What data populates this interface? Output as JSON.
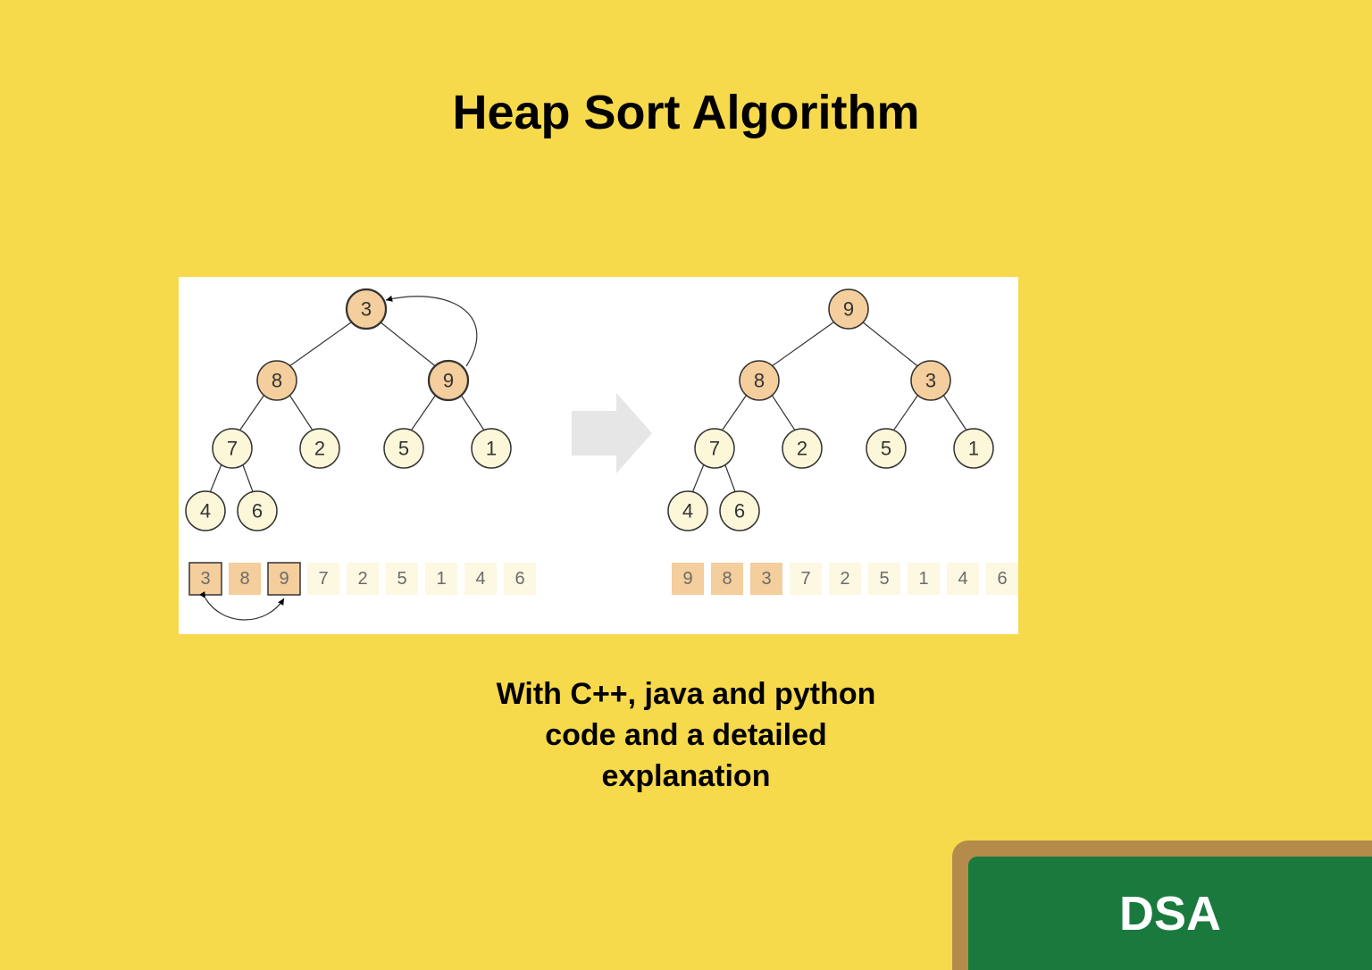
{
  "title": "Heap Sort Algorithm",
  "subtitle_line1": "With C++, java and python",
  "subtitle_line2": "code and a detailed",
  "subtitle_line3": "explanation",
  "board_label": "DSA",
  "colors": {
    "background": "#f7d94c",
    "panel": "#ffffff",
    "node_light": "#fdf7da",
    "node_dark": "#f4ce9c",
    "board_frame": "#b48b4a",
    "board_inner": "#1a7a3e"
  },
  "diagram": {
    "left_tree": {
      "nodes": [
        {
          "id": "L0",
          "value": 3,
          "shade": "dark",
          "bold": true
        },
        {
          "id": "L1",
          "value": 8,
          "shade": "dark",
          "bold": false
        },
        {
          "id": "L2",
          "value": 9,
          "shade": "dark",
          "bold": true
        },
        {
          "id": "L3",
          "value": 7,
          "shade": "light",
          "bold": false
        },
        {
          "id": "L4",
          "value": 2,
          "shade": "light",
          "bold": false
        },
        {
          "id": "L5",
          "value": 5,
          "shade": "light",
          "bold": false
        },
        {
          "id": "L6",
          "value": 1,
          "shade": "light",
          "bold": false
        },
        {
          "id": "L7",
          "value": 4,
          "shade": "light",
          "bold": false
        },
        {
          "id": "L8",
          "value": 6,
          "shade": "light",
          "bold": false
        }
      ],
      "edges": [
        [
          "L0",
          "L1"
        ],
        [
          "L0",
          "L2"
        ],
        [
          "L1",
          "L3"
        ],
        [
          "L1",
          "L4"
        ],
        [
          "L2",
          "L5"
        ],
        [
          "L2",
          "L6"
        ],
        [
          "L3",
          "L7"
        ],
        [
          "L3",
          "L8"
        ]
      ],
      "swap_arrow_tree": [
        "L0",
        "L2"
      ],
      "array": [
        3,
        8,
        9,
        7,
        2,
        5,
        1,
        4,
        6
      ],
      "array_highlight_indices": [
        0,
        1,
        2
      ],
      "array_border_indices": [
        0,
        2
      ],
      "array_swap_arrow": [
        0,
        2
      ]
    },
    "right_tree": {
      "nodes": [
        {
          "id": "R0",
          "value": 9,
          "shade": "dark"
        },
        {
          "id": "R1",
          "value": 8,
          "shade": "dark"
        },
        {
          "id": "R2",
          "value": 3,
          "shade": "dark"
        },
        {
          "id": "R3",
          "value": 7,
          "shade": "light"
        },
        {
          "id": "R4",
          "value": 2,
          "shade": "light"
        },
        {
          "id": "R5",
          "value": 5,
          "shade": "light"
        },
        {
          "id": "R6",
          "value": 1,
          "shade": "light"
        },
        {
          "id": "R7",
          "value": 4,
          "shade": "light"
        },
        {
          "id": "R8",
          "value": 6,
          "shade": "light"
        }
      ],
      "edges": [
        [
          "R0",
          "R1"
        ],
        [
          "R0",
          "R2"
        ],
        [
          "R1",
          "R3"
        ],
        [
          "R1",
          "R4"
        ],
        [
          "R2",
          "R5"
        ],
        [
          "R2",
          "R6"
        ],
        [
          "R3",
          "R7"
        ],
        [
          "R3",
          "R8"
        ]
      ],
      "array": [
        9,
        8,
        3,
        7,
        2,
        5,
        1,
        4,
        6
      ],
      "array_highlight_indices": [
        0,
        1,
        2
      ]
    }
  }
}
